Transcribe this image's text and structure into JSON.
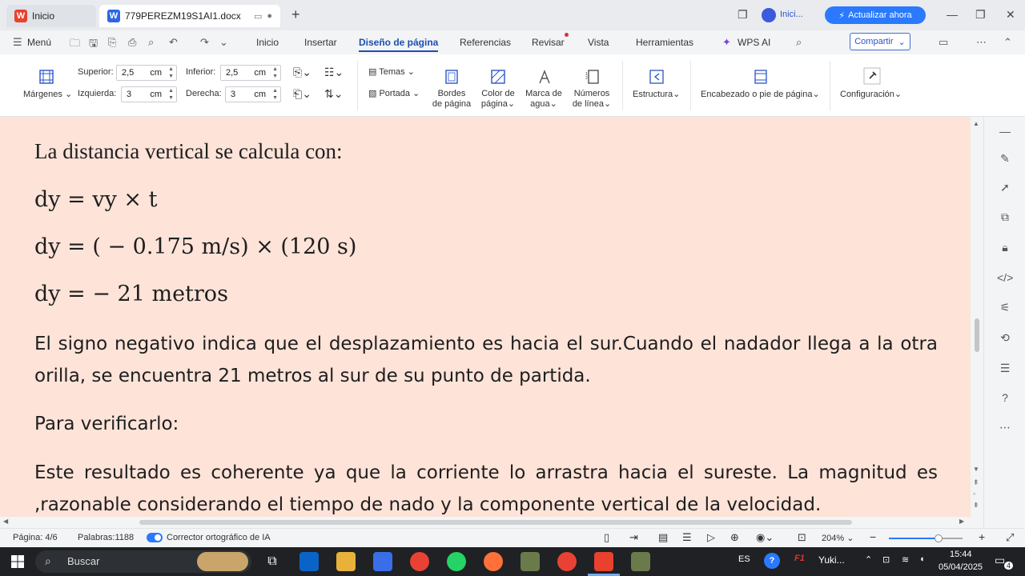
{
  "titlebar": {
    "home_tab": "Inicio",
    "doc_tab": "779PEREZM19S1AI1.docx",
    "upgrade_label": "Actualizar ahora",
    "user_label": "Inici..."
  },
  "menubar": {
    "menu_label": "Menú",
    "items": [
      "Inicio",
      "Insertar",
      "Diseño de página",
      "Referencias",
      "Revisar",
      "Vista",
      "Herramientas",
      "WPS AI"
    ],
    "active": "Diseño de página",
    "share_label": "Compartir"
  },
  "ribbon": {
    "margins_label": "Márgenes",
    "top_label": "Superior:",
    "top_value": "2,5",
    "bottom_label": "Inferior:",
    "bottom_value": "2,5",
    "left_label": "Izquierda:",
    "left_value": "3",
    "right_label": "Derecha:",
    "right_value": "3",
    "unit": "cm",
    "themes_label": "Temas",
    "cover_label": "Portada",
    "borders_label_1": "Bordes",
    "borders_label_2": "de página",
    "color_label_1": "Color de",
    "color_label_2": "página",
    "watermark_label_1": "Marca de",
    "watermark_label_2": "agua",
    "linenum_label_1": "Números",
    "linenum_label_2": "de línea",
    "structure_label": "Estructura",
    "header_footer_label": "Encabezado o pie de página",
    "config_label": "Configuración"
  },
  "document": {
    "line1": "La distancia vertical se calcula con:",
    "eq1": "dy  =  vy  ×  t",
    "eq2": "dy  =  ( − 0.175 m/s)  ×  (120 s)",
    "eq3": "dy  =  − 21 metros",
    "para1": "El signo negativo indica que el desplazamiento es hacia el sur.Cuando el nadador llega a la otra orilla, se encuentra 21 metros al sur de su punto de partida.",
    "para2": "Para verificarlo:",
    "para3": "Este resultado es coherente ya que la corriente lo arrastra hacia el sureste. La magnitud es ,razonable considerando el tiempo de nado y la componente vertical de la velocidad."
  },
  "statusbar": {
    "page": "Página: 4/6",
    "words": "Palabras:1188",
    "spellcheck": "Corrector ortográfico de IA",
    "zoom": "204%",
    "zoom_fraction": 0.67
  },
  "taskbar": {
    "search_placeholder": "Buscar",
    "language": "ES",
    "app_label": "Yuki...",
    "time": "15:44",
    "date": "05/04/2025",
    "notifications": "4"
  },
  "colors": {
    "accent": "#1a4fb0",
    "page_background": "#fde3d8",
    "upgrade": "#2a79ff"
  }
}
